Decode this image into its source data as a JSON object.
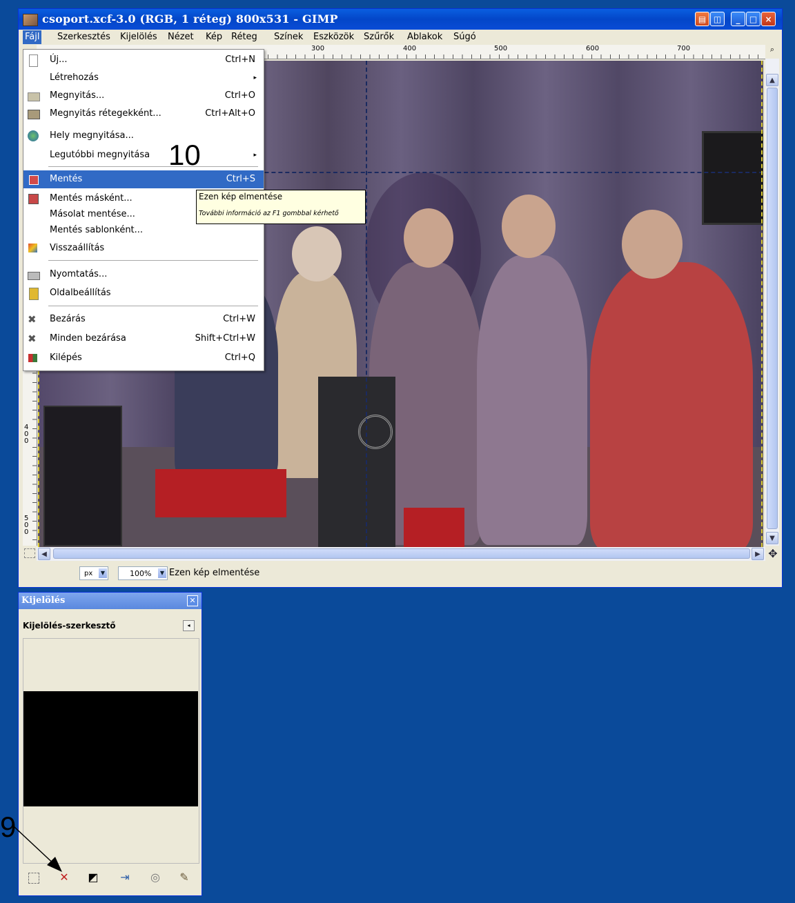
{
  "window": {
    "title": "csoport.xcf-3.0 (RGB, 1 réteg) 800x531 - GIMP",
    "buttons": {
      "minimize": "_",
      "maximize": "□",
      "close": "×"
    }
  },
  "menubar": {
    "items": [
      "Fájl",
      "Szerkesztés",
      "Kijelölés",
      "Nézet",
      "Kép",
      "Réteg",
      "Színek",
      "Eszközök",
      "Szűrők",
      "Ablakok",
      "Súgó"
    ]
  },
  "ruler": {
    "h_labels": [
      "300",
      "400",
      "500",
      "600",
      "700"
    ],
    "v_labels": [
      "400",
      "500"
    ]
  },
  "file_menu": {
    "items": [
      {
        "label": "Új...",
        "shortcut": "Ctrl+N",
        "icon": "new-file-icon"
      },
      {
        "label": "Létrehozás",
        "submenu": "▸"
      },
      {
        "label": "Megnyitás...",
        "shortcut": "Ctrl+O",
        "icon": "open-folder-icon"
      },
      {
        "label": "Megnyitás rétegekként...",
        "shortcut": "Ctrl+Alt+O",
        "icon": "open-layers-icon"
      },
      {
        "label": "Hely megnyitása...",
        "icon": "globe-icon"
      },
      {
        "label": "Legutóbbi megnyitása",
        "submenu": "▸"
      },
      {
        "label": "Mentés",
        "shortcut": "Ctrl+S",
        "icon": "save-icon"
      },
      {
        "label": "Mentés másként...",
        "icon": "save-as-icon"
      },
      {
        "label": "Másolat mentése..."
      },
      {
        "label": "Mentés sablonként..."
      },
      {
        "label": "Visszaállítás",
        "icon": "revert-icon"
      },
      {
        "label": "Nyomtatás...",
        "icon": "print-icon"
      },
      {
        "label": "Oldalbeállítás",
        "icon": "page-setup-icon"
      },
      {
        "label": "Bezárás",
        "shortcut": "Ctrl+W",
        "icon": "close-x-icon"
      },
      {
        "label": "Minden bezárása",
        "shortcut": "Shift+Ctrl+W",
        "icon": "close-all-icon"
      },
      {
        "label": "Kilépés",
        "shortcut": "Ctrl+Q",
        "icon": "quit-icon"
      }
    ]
  },
  "tooltip": {
    "title": "Ezen kép elmentése",
    "hint": "További információ az F1 gombbal kérhető"
  },
  "annotations": {
    "ten": "10",
    "nine": "9"
  },
  "statusbar": {
    "unit": "px",
    "zoom": "100%",
    "message": "Ezen kép elmentése"
  },
  "dock": {
    "title": "Kijelölés",
    "subtitle": "Kijelölés-szerkesztő",
    "buttons": [
      "selection-all-icon",
      "select-none-icon",
      "invert-selection-icon",
      "selection-to-path-icon",
      "stroke-selection-icon",
      "paint-selection-icon"
    ]
  },
  "colors": {
    "titlebar": "#0346c8",
    "highlight": "#316ac5",
    "desktop": "#0a4a9a",
    "tooltip_bg": "#ffffe1"
  }
}
